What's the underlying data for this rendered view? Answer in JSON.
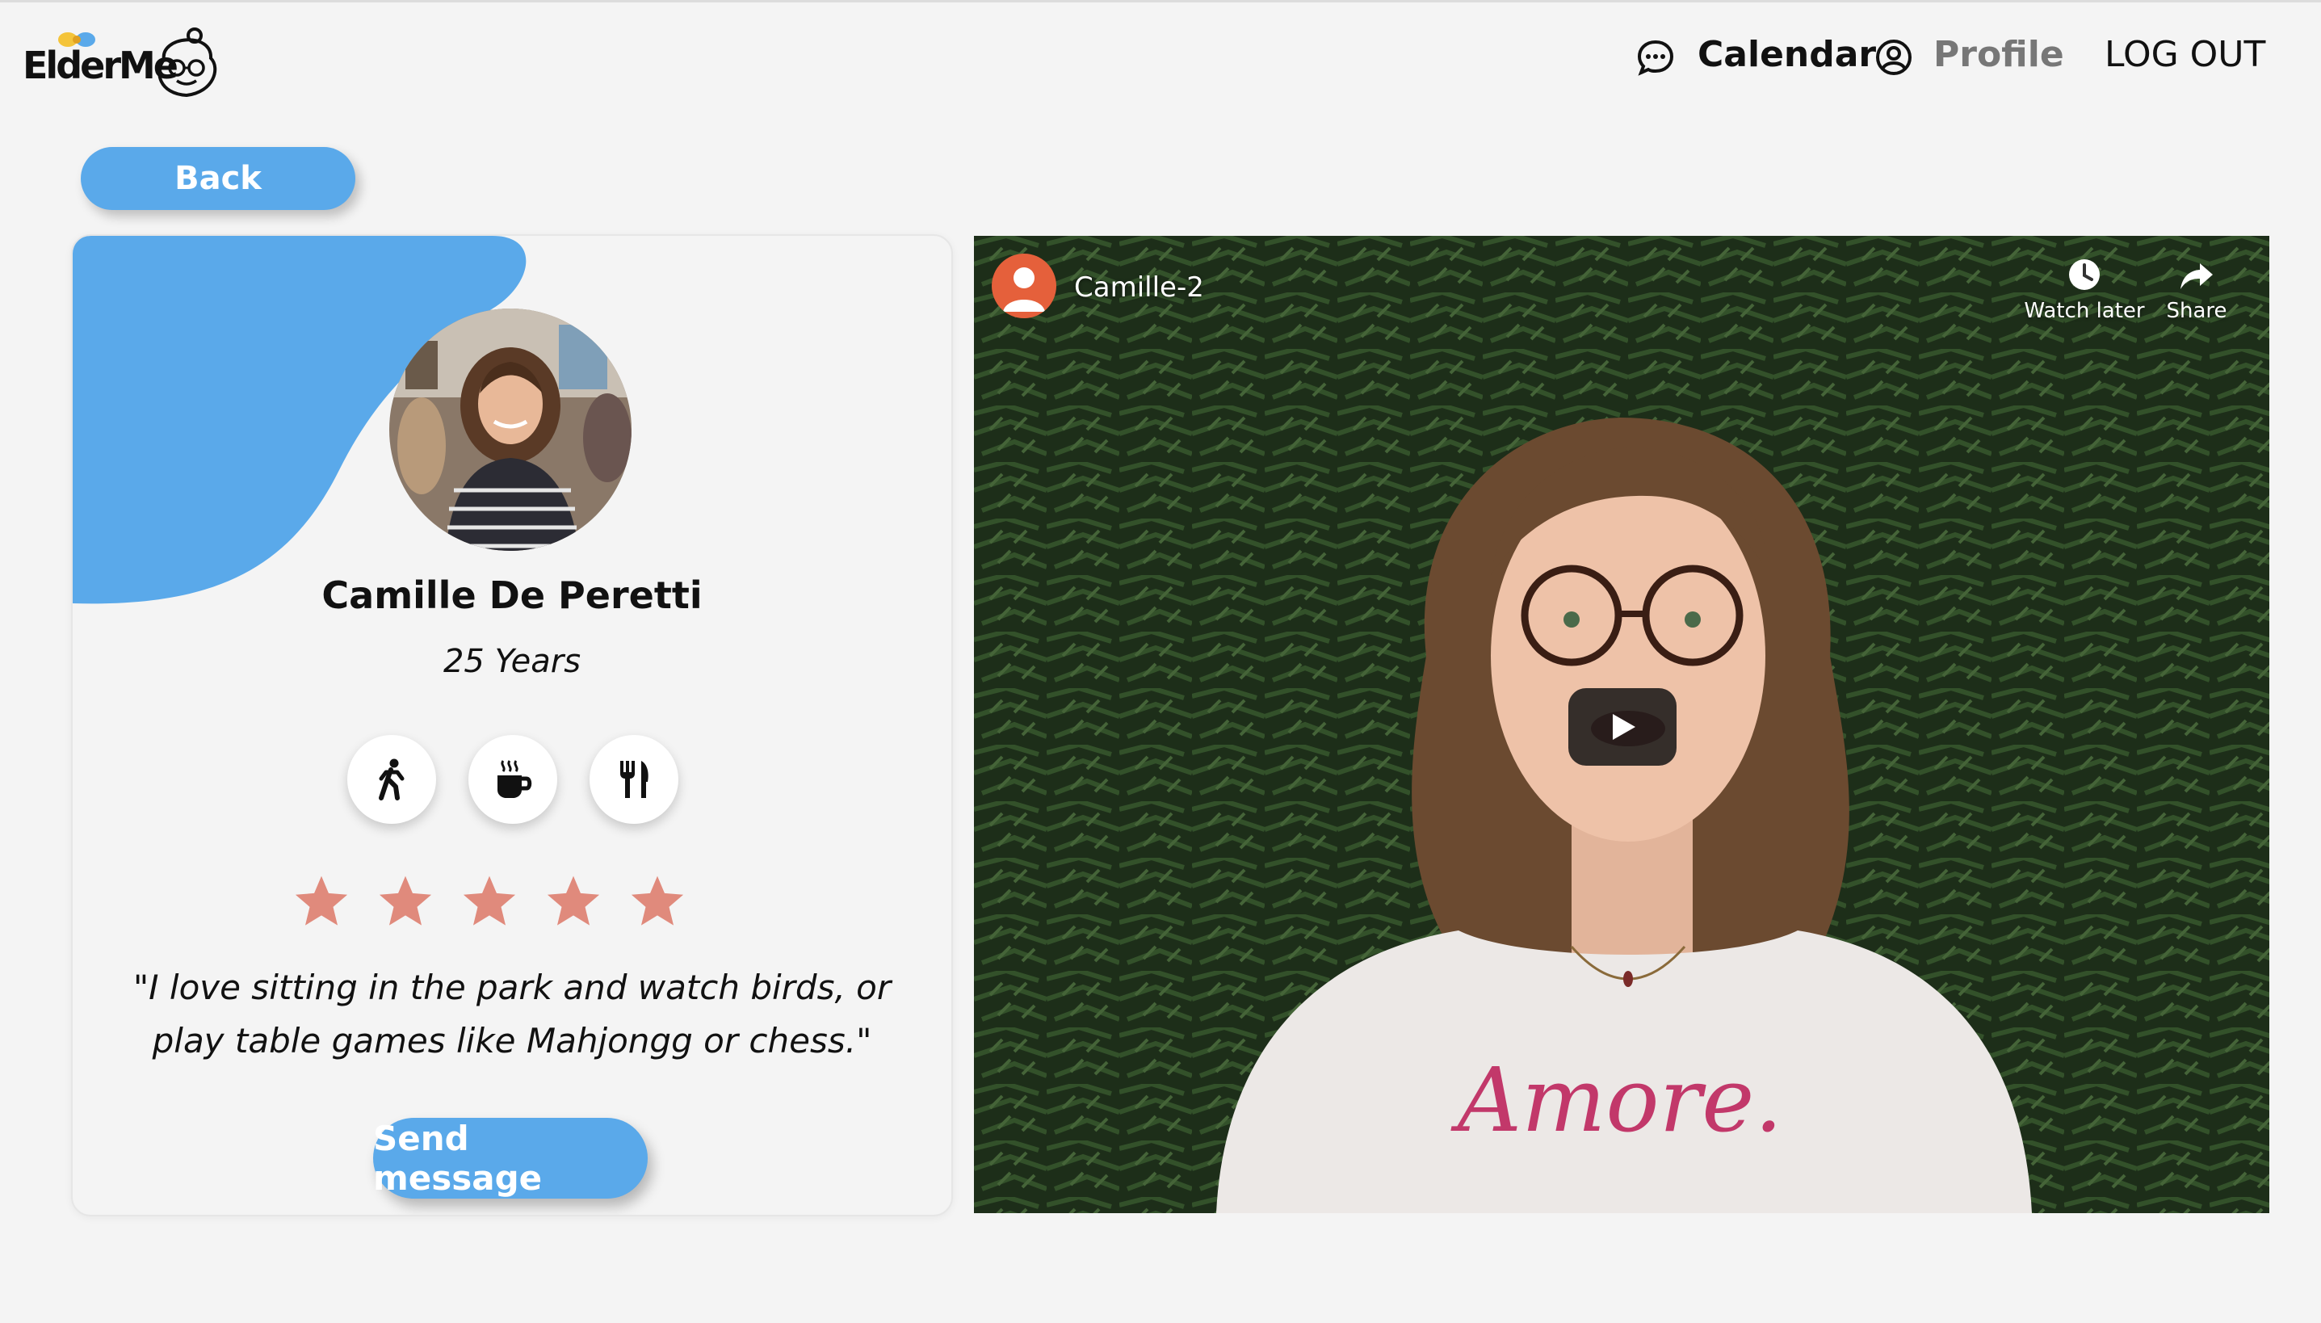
{
  "header": {
    "logo_text": "ElderMe",
    "nav": {
      "calendar_label": "Calendar",
      "profile_label": "Profile",
      "logout_label": "LOG OUT"
    }
  },
  "back_label": "Back",
  "profile": {
    "name": "Camille De Peretti",
    "age": "25 Years",
    "interests": [
      "walking-icon",
      "coffee-icon",
      "dining-icon"
    ],
    "rating": 5,
    "quote": "\"I love sitting in the park and watch birds, or play table games like Mahjongg or chess.\"",
    "send_label": "Send message"
  },
  "video": {
    "channel_title": "Camille-2",
    "watch_later_label": "Watch later",
    "share_label": "Share",
    "shirt_text": "Amore."
  },
  "colors": {
    "accent": "#5aa9ea",
    "star": "#e08a7c",
    "background": "#f4f4f4"
  }
}
